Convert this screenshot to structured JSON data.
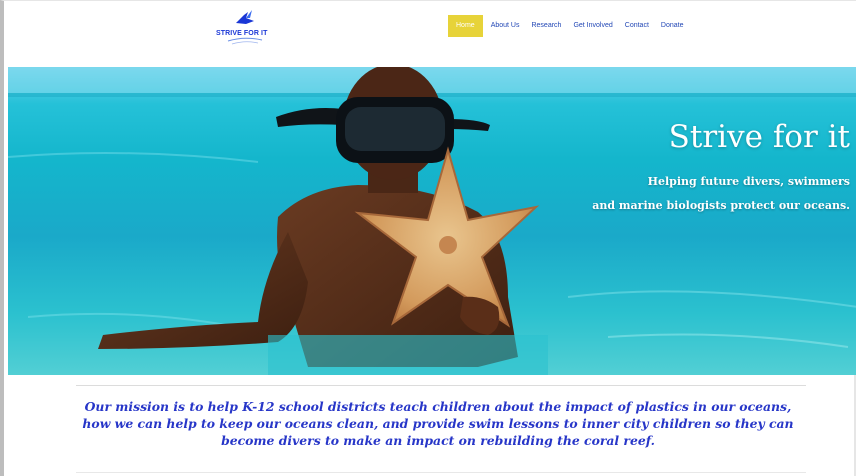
{
  "logo": {
    "text": "STRIVE FOR IT"
  },
  "nav": {
    "items": [
      {
        "label": "Home",
        "active": true
      },
      {
        "label": "About Us",
        "active": false
      },
      {
        "label": "Research",
        "active": false
      },
      {
        "label": "Get Involved",
        "active": false
      },
      {
        "label": "Contact",
        "active": false
      },
      {
        "label": "Donate",
        "active": false
      }
    ]
  },
  "hero": {
    "title": "Strive for it",
    "subtitle_line1": "Helping future divers, swimmers",
    "subtitle_line2": "and marine biologists protect our oceans."
  },
  "mission": {
    "text": "Our mission is to help K-12 school districts teach children about the impact of plastics in our oceans, how we can help to keep our oceans clean, and provide swim lessons to inner city children so they can become divers to make an impact on rebuilding the coral reef."
  },
  "colors": {
    "accent_yellow": "#e7d339",
    "nav_text": "#2348b6",
    "mission_text": "#2736c8",
    "logo_blue": "#1a37d6"
  }
}
